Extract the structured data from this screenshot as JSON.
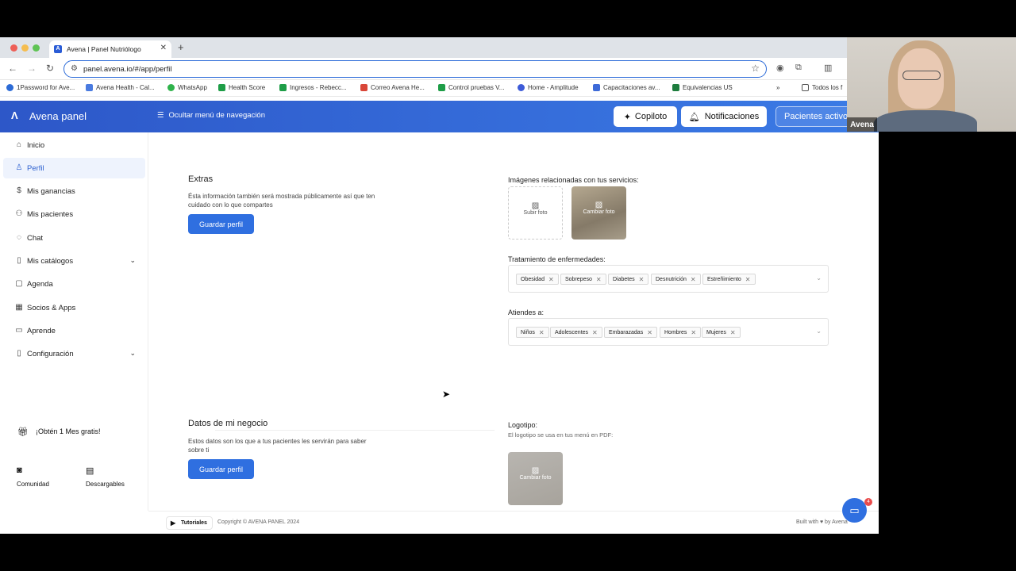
{
  "browser": {
    "tab_title": "Avena | Panel Nutriólogo",
    "tab_favicon_letter": "A",
    "url": "panel.avena.io/#/app/perfil",
    "bookmarks": [
      "1Password for Ave...",
      "Avena Health - Cal...",
      "WhatsApp",
      "Health Score",
      "Ingresos - Rebecc...",
      "Correo Avena He...",
      "Control pruebas V...",
      "Home - Amplitude",
      "Capacitaciones av...",
      "Equivalencias US"
    ],
    "bookmarks_overflow": "Todos los f"
  },
  "header": {
    "brand": "Avena panel",
    "hide_nav": "Ocultar menú de navegación",
    "copilot": "Copiloto",
    "notifications": "Notificaciones",
    "active_patients": "Pacientes activos"
  },
  "sidebar": {
    "items": [
      {
        "label": "Inicio",
        "icon": "home-icon"
      },
      {
        "label": "Perfil",
        "icon": "user-icon"
      },
      {
        "label": "Mis ganancias",
        "icon": "dollar-icon"
      },
      {
        "label": "Mis pacientes",
        "icon": "users-icon"
      },
      {
        "label": "Chat",
        "icon": "chat-icon"
      },
      {
        "label": "Mis catálogos",
        "icon": "book-icon"
      },
      {
        "label": "Agenda",
        "icon": "calendar-icon"
      },
      {
        "label": "Socios & Apps",
        "icon": "grid-icon"
      },
      {
        "label": "Aprende",
        "icon": "book-open-icon"
      },
      {
        "label": "Configuración",
        "icon": "settings-icon"
      }
    ],
    "active": "Perfil",
    "promo": "¡Obtén 1 Mes gratis!",
    "community": "Comunidad",
    "downloads": "Descargables"
  },
  "extras": {
    "title": "Extras",
    "description": "Ésta información también será mostrada públicamente así que ten cuidado con lo que compartes",
    "save": "Guardar perfil",
    "images_label": "Imágenes relacionadas con tus servicios:",
    "upload": "Subir foto",
    "change": "Cambiar foto",
    "treatment_label": "Tratamiento de enfermedades:",
    "treatments": [
      "Obesidad",
      "Sobrepeso",
      "Diabetes",
      "Desnutrición",
      "Estreñimiento"
    ],
    "attends_label": "Atiendes a:",
    "attends": [
      "Niños",
      "Adolescentes",
      "Embarazadas",
      "Hombres",
      "Mujeres"
    ]
  },
  "business": {
    "title": "Datos de mi negocio",
    "description": "Estos datos son los que a tus pacientes les servirán para saber sobre ti",
    "save": "Guardar perfil",
    "logo_label": "Logotipo:",
    "logo_sub": "El logotipo se usa en tus menú en PDF:",
    "change": "Cambiar foto"
  },
  "footer": {
    "tutorials": "Tutoriales",
    "copyright": "Copyright © AVENA PANEL 2024",
    "built": "Built with ♥ by Avena"
  },
  "chat_badge": "4",
  "webcam_label": "Avena",
  "colors": {
    "primary": "#2f6fe0",
    "header_start": "#2d57c8",
    "header_end": "#3b7be6"
  }
}
